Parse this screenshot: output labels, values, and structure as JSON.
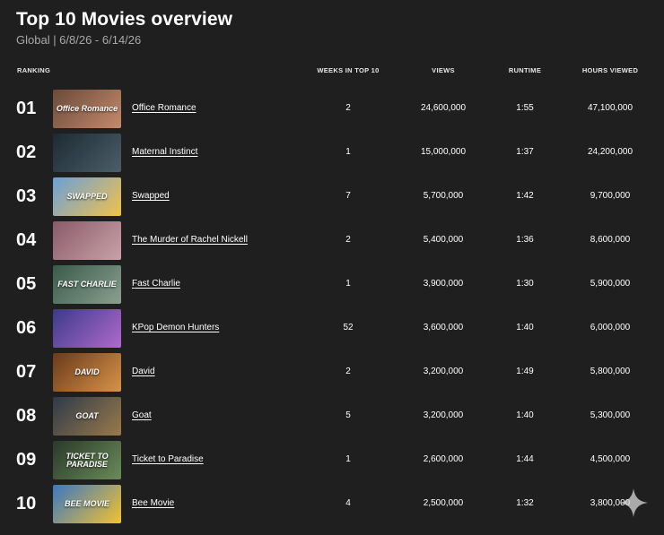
{
  "header": {
    "title": "Top 10 Movies overview",
    "subtitle": "Global | 6/8/26 - 6/14/26"
  },
  "columns": {
    "ranking": "RANKING",
    "weeks": "WEEKS IN TOP 10",
    "views": "VIEWS",
    "runtime": "RUNTIME",
    "hours": "HOURS VIEWED"
  },
  "rows": [
    {
      "rank": "01",
      "title": "Office Romance",
      "weeks": "2",
      "views": "24,600,000",
      "runtime": "1:55",
      "hours": "47,100,000",
      "thumb_text": "Office Romance",
      "thumb_colors": [
        "#6b4a3a",
        "#c48a6c"
      ]
    },
    {
      "rank": "02",
      "title": "Maternal Instinct",
      "weeks": "1",
      "views": "15,000,000",
      "runtime": "1:37",
      "hours": "24,200,000",
      "thumb_text": "",
      "thumb_colors": [
        "#1c2a33",
        "#4c5e68"
      ]
    },
    {
      "rank": "03",
      "title": "Swapped",
      "weeks": "7",
      "views": "5,700,000",
      "runtime": "1:42",
      "hours": "9,700,000",
      "thumb_text": "SWAPPED",
      "thumb_colors": [
        "#6aa0d8",
        "#f2c14a"
      ]
    },
    {
      "rank": "04",
      "title": "The Murder of Rachel Nickell",
      "weeks": "2",
      "views": "5,400,000",
      "runtime": "1:36",
      "hours": "8,600,000",
      "thumb_text": "",
      "thumb_colors": [
        "#8a5a6a",
        "#c9a2a8"
      ]
    },
    {
      "rank": "05",
      "title": "Fast Charlie",
      "weeks": "1",
      "views": "3,900,000",
      "runtime": "1:30",
      "hours": "5,900,000",
      "thumb_text": "FAST CHARLIE",
      "thumb_colors": [
        "#3a5a4a",
        "#8aa090"
      ]
    },
    {
      "rank": "06",
      "title": "KPop Demon Hunters",
      "weeks": "52",
      "views": "3,600,000",
      "runtime": "1:40",
      "hours": "6,000,000",
      "thumb_text": "",
      "thumb_colors": [
        "#3b3a8a",
        "#b06acc"
      ]
    },
    {
      "rank": "07",
      "title": "David",
      "weeks": "2",
      "views": "3,200,000",
      "runtime": "1:49",
      "hours": "5,800,000",
      "thumb_text": "DAVID",
      "thumb_colors": [
        "#6a3a1a",
        "#d8934a"
      ]
    },
    {
      "rank": "08",
      "title": "Goat",
      "weeks": "5",
      "views": "3,200,000",
      "runtime": "1:40",
      "hours": "5,300,000",
      "thumb_text": "GOAT",
      "thumb_colors": [
        "#2e3a4a",
        "#9a7a4a"
      ]
    },
    {
      "rank": "09",
      "title": "Ticket to Paradise",
      "weeks": "1",
      "views": "2,600,000",
      "runtime": "1:44",
      "hours": "4,500,000",
      "thumb_text": "TICKET TO PARADISE",
      "thumb_colors": [
        "#2a3a2a",
        "#6a8a5a"
      ]
    },
    {
      "rank": "10",
      "title": "Bee Movie",
      "weeks": "4",
      "views": "2,500,000",
      "runtime": "1:32",
      "hours": "3,800,000",
      "thumb_text": "BEE MOVIE",
      "thumb_colors": [
        "#3a78c0",
        "#f2c230"
      ]
    }
  ],
  "colors": {
    "background": "#1f1f1f",
    "text": "#ffffff",
    "muted": "#a8a8a8"
  },
  "icons": {
    "corner": "sparkle-icon"
  }
}
